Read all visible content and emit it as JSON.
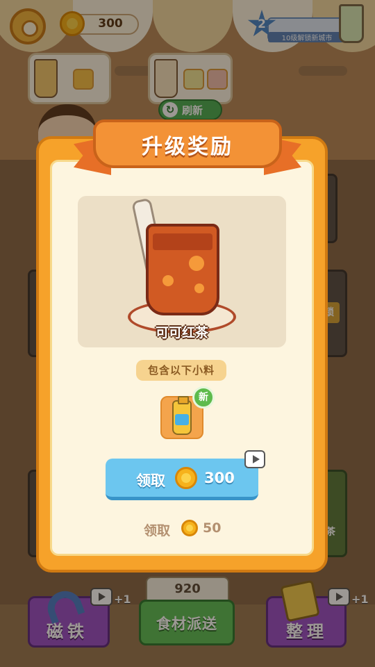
{
  "hud": {
    "coins": "300",
    "level": "2",
    "level_hint": "10级解锁新城市"
  },
  "orders": {
    "refresh_label": "刷新"
  },
  "modal": {
    "title": "升级奖励",
    "drink_name": "可可红茶",
    "toppings_header": "包含以下小料",
    "new_badge": "新",
    "claim_label": "领取",
    "claim_amount": "300",
    "free_label": "领取",
    "free_amount": "50"
  },
  "bottom": {
    "magnet_label": "磁铁",
    "magnet_bonus": "+1",
    "deliver_count": "920",
    "deliver_label": "食材派送",
    "sort_label": "整理",
    "sort_bonus": "+1"
  },
  "side_items": {
    "lock_label": "锁",
    "tea_label": "茶"
  },
  "colors": {
    "modal_orange": "#f6a22a",
    "ribbon": "#f39236",
    "claim_blue": "#6cc6ef",
    "new_green": "#5dbb4c",
    "bottom_purple": "#9b52c9",
    "deliver_green": "#5fbf5a"
  }
}
